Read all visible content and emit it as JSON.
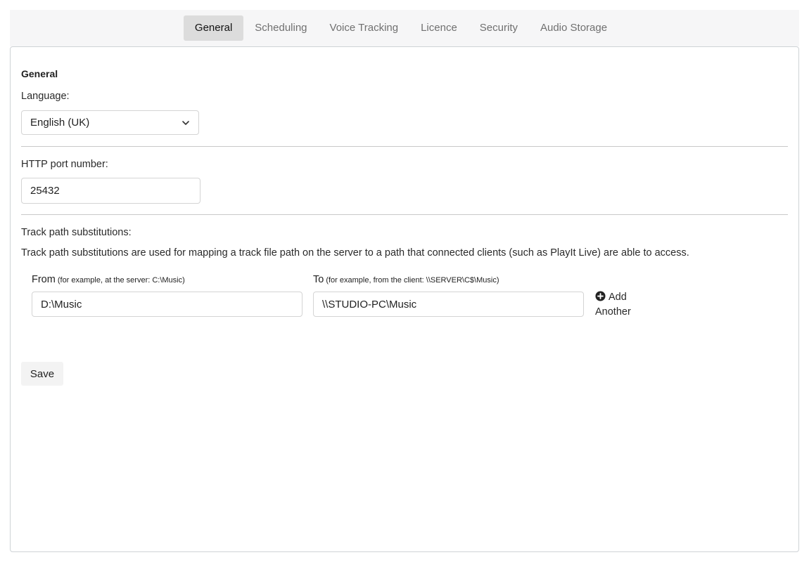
{
  "tabs": [
    {
      "label": "General",
      "active": true
    },
    {
      "label": "Scheduling",
      "active": false
    },
    {
      "label": "Voice Tracking",
      "active": false
    },
    {
      "label": "Licence",
      "active": false
    },
    {
      "label": "Security",
      "active": false
    },
    {
      "label": "Audio Storage",
      "active": false
    }
  ],
  "general": {
    "section_title": "General",
    "language_label": "Language:",
    "language_value": "English (UK)",
    "http_port_label": "HTTP port number:",
    "http_port_value": "25432"
  },
  "substitutions": {
    "label": "Track path substitutions:",
    "description": "Track path substitutions are used for mapping a track file path on the server to a path that connected clients (such as PlayIt Live) are able to access.",
    "from_label": "From",
    "from_hint": "(for example, at the server: C:\\Music)",
    "to_label": "To",
    "to_hint": "(for example, from the client: \\\\SERVER\\C$\\Music)",
    "from_value": "D:\\Music",
    "to_value": "\\\\STUDIO-PC\\Music",
    "add_another_label": "Add Another",
    "add_icon": "plus-circle-icon"
  },
  "actions": {
    "save_label": "Save"
  },
  "colors": {
    "tabbar_bg": "#f6f6f7",
    "active_tab_bg": "#dcdcdc",
    "border": "#cfd3d6"
  }
}
